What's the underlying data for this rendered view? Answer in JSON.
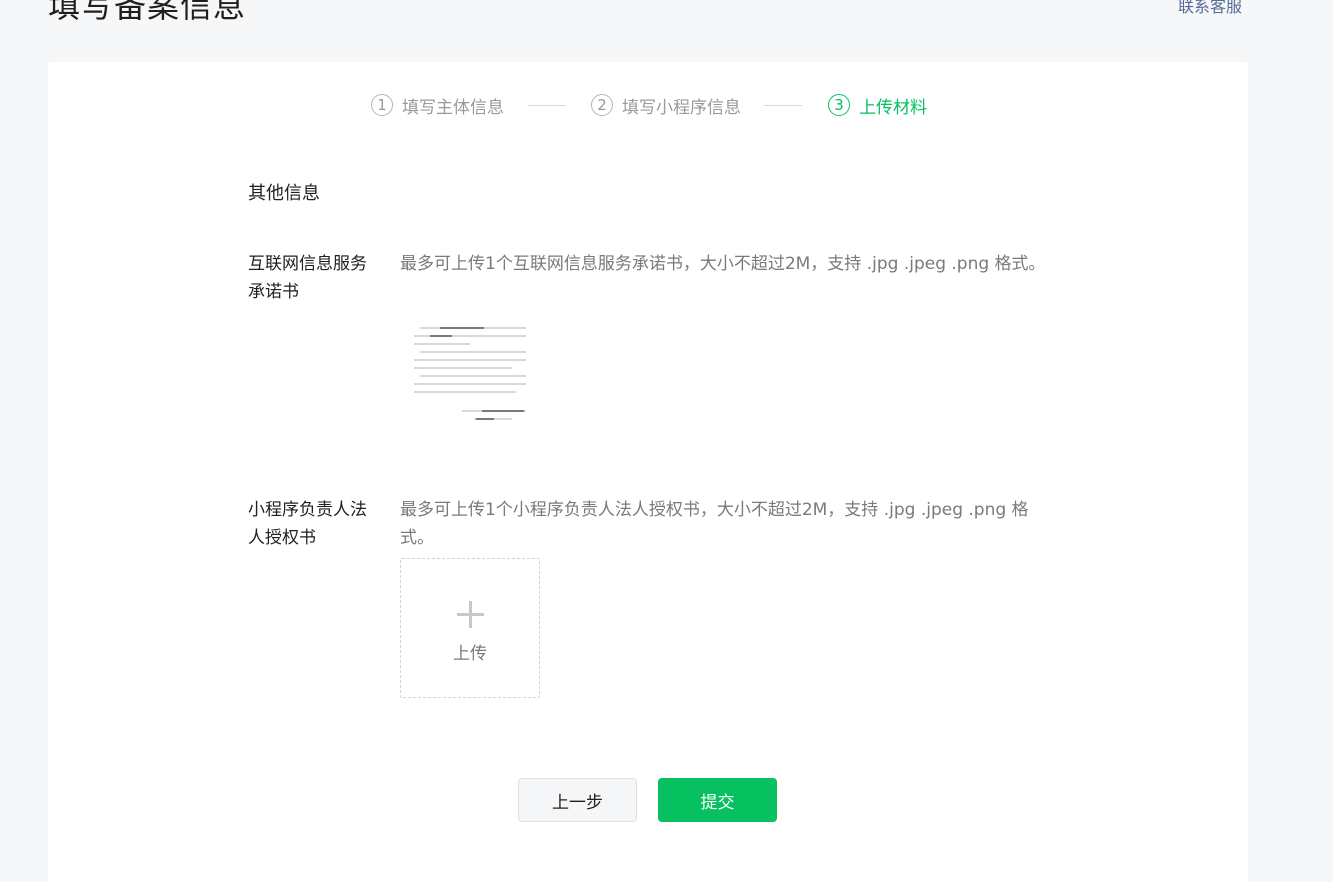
{
  "header": {
    "title": "填写备案信息",
    "contact_link": "联系客服"
  },
  "steps": [
    {
      "number": "1",
      "label": "填写主体信息",
      "state": "done"
    },
    {
      "number": "2",
      "label": "填写小程序信息",
      "state": "done"
    },
    {
      "number": "3",
      "label": "上传材料",
      "state": "active"
    }
  ],
  "section": {
    "title": "其他信息"
  },
  "fields": {
    "commitment": {
      "label": "互联网信息服务承诺书",
      "tip": "最多可上传1个互联网信息服务承诺书，大小不超过2M，支持 .jpg .jpeg .png 格式。"
    },
    "authorization": {
      "label": "小程序负责人法人授权书",
      "tip": "最多可上传1个小程序负责人法人授权书，大小不超过2M，支持 .jpg .jpeg .png 格式。",
      "upload_label": "上传"
    }
  },
  "buttons": {
    "prev": "上一步",
    "submit": "提交"
  },
  "colors": {
    "accent": "#07c160",
    "link": "#576b95",
    "muted": "#7a7a7a",
    "background": "#f6f7f9"
  }
}
